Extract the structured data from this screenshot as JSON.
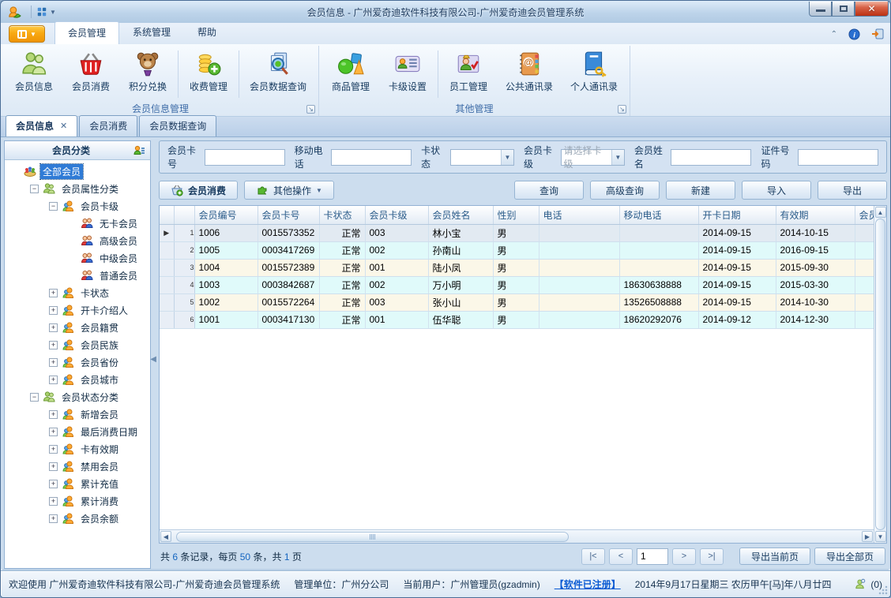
{
  "window": {
    "title": "会员信息 - 广州爱奇迪软件科技有限公司-广州爱奇迪会员管理系统"
  },
  "ribbon": {
    "tabs": [
      "会员管理",
      "系统管理",
      "帮助"
    ],
    "groups": [
      {
        "label": "会员信息管理",
        "buttons": [
          {
            "label": "会员信息",
            "icon": "members-icon"
          },
          {
            "label": "会员消费",
            "icon": "basket-icon"
          },
          {
            "label": "积分兑换",
            "icon": "teddy-icon"
          },
          {
            "label": "收费管理",
            "icon": "coins-icon"
          },
          {
            "label": "会员数据查询",
            "icon": "doc-search-icon"
          }
        ]
      },
      {
        "label": "其他管理",
        "buttons": [
          {
            "label": "商品管理",
            "icon": "goods-icon"
          },
          {
            "label": "卡级设置",
            "icon": "card-icon"
          },
          {
            "label": "员工管理",
            "icon": "staff-icon"
          },
          {
            "label": "公共通讯录",
            "icon": "address-book-icon"
          },
          {
            "label": "个人通讯录",
            "icon": "personal-book-icon"
          }
        ]
      }
    ]
  },
  "doc_tabs": [
    "会员信息",
    "会员消费",
    "会员数据查询"
  ],
  "sidebar": {
    "header": "会员分类",
    "tree": [
      {
        "label": "全部会员",
        "level": 0,
        "expander": "none",
        "icon": "root",
        "selected": true
      },
      {
        "label": "会员属性分类",
        "level": 1,
        "expander": "minus",
        "icon": "cat"
      },
      {
        "label": "会员卡级",
        "level": 2,
        "expander": "minus",
        "icon": "sub"
      },
      {
        "label": "无卡会员",
        "level": 3,
        "expander": "none",
        "icon": "leaf"
      },
      {
        "label": "高级会员",
        "level": 3,
        "expander": "none",
        "icon": "leaf"
      },
      {
        "label": "中级会员",
        "level": 3,
        "expander": "none",
        "icon": "leaf"
      },
      {
        "label": "普通会员",
        "level": 3,
        "expander": "none",
        "icon": "leaf"
      },
      {
        "label": "卡状态",
        "level": 2,
        "expander": "plus",
        "icon": "sub"
      },
      {
        "label": "开卡介绍人",
        "level": 2,
        "expander": "plus",
        "icon": "sub"
      },
      {
        "label": "会员籍贯",
        "level": 2,
        "expander": "plus",
        "icon": "sub"
      },
      {
        "label": "会员民族",
        "level": 2,
        "expander": "plus",
        "icon": "sub"
      },
      {
        "label": "会员省份",
        "level": 2,
        "expander": "plus",
        "icon": "sub"
      },
      {
        "label": "会员城市",
        "level": 2,
        "expander": "plus",
        "icon": "sub"
      },
      {
        "label": "会员状态分类",
        "level": 1,
        "expander": "minus",
        "icon": "cat"
      },
      {
        "label": "新增会员",
        "level": 2,
        "expander": "plus",
        "icon": "sub"
      },
      {
        "label": "最后消费日期",
        "level": 2,
        "expander": "plus",
        "icon": "sub"
      },
      {
        "label": "卡有效期",
        "level": 2,
        "expander": "plus",
        "icon": "sub"
      },
      {
        "label": "禁用会员",
        "level": 2,
        "expander": "plus",
        "icon": "sub"
      },
      {
        "label": "累计充值",
        "level": 2,
        "expander": "plus",
        "icon": "sub"
      },
      {
        "label": "累计消费",
        "level": 2,
        "expander": "plus",
        "icon": "sub"
      },
      {
        "label": "会员余额",
        "level": 2,
        "expander": "plus",
        "icon": "sub"
      }
    ]
  },
  "filters": [
    {
      "label": "会员卡号",
      "type": "input",
      "value": ""
    },
    {
      "label": "移动电话",
      "type": "input",
      "value": ""
    },
    {
      "label": "卡状态",
      "type": "select",
      "value": ""
    },
    {
      "label": "会员卡级",
      "type": "select",
      "value": "请选择卡级"
    },
    {
      "label": "会员姓名",
      "type": "input",
      "value": ""
    },
    {
      "label": "证件号码",
      "type": "input",
      "value": ""
    }
  ],
  "toolbar": {
    "consume_label": "会员消费",
    "other_ops_label": "其他操作",
    "right_buttons": [
      "查询",
      "高级查询",
      "新建",
      "导入",
      "导出"
    ]
  },
  "table": {
    "columns": [
      "会员编号",
      "会员卡号",
      "卡状态",
      "会员卡级",
      "会员姓名",
      "性别",
      "电话",
      "移动电话",
      "开卡日期",
      "有效期",
      "会员"
    ],
    "rows": [
      {
        "num": "1",
        "current": true,
        "cells": [
          "1006",
          "0015573352",
          "正常",
          "003",
          "林小宝",
          "男",
          "",
          "",
          "2014-09-15",
          "2014-10-15",
          ""
        ]
      },
      {
        "num": "2",
        "current": false,
        "cells": [
          "1005",
          "0003417269",
          "正常",
          "002",
          "孙南山",
          "男",
          "",
          "",
          "2014-09-15",
          "2016-09-15",
          ""
        ]
      },
      {
        "num": "3",
        "current": false,
        "cells": [
          "1004",
          "0015572389",
          "正常",
          "001",
          "陆小凤",
          "男",
          "",
          "",
          "2014-09-15",
          "2015-09-30",
          ""
        ]
      },
      {
        "num": "4",
        "current": false,
        "cells": [
          "1003",
          "0003842687",
          "正常",
          "002",
          "万小明",
          "男",
          "",
          "18630638888",
          "2014-09-15",
          "2015-03-30",
          ""
        ]
      },
      {
        "num": "5",
        "current": false,
        "cells": [
          "1002",
          "0015572264",
          "正常",
          "003",
          "张小山",
          "男",
          "",
          "13526508888",
          "2014-09-15",
          "2014-10-30",
          ""
        ]
      },
      {
        "num": "6",
        "current": false,
        "cells": [
          "1001",
          "0003417130",
          "正常",
          "001",
          "伍华聪",
          "男",
          "",
          "18620292076",
          "2014-09-12",
          "2014-12-30",
          ""
        ]
      }
    ]
  },
  "pagination": {
    "t1": "共",
    "n1": "6",
    "t2": "条记录，每页",
    "n2": "50",
    "t3": "条，共",
    "n3": "1",
    "t4": "页",
    "first": "|<",
    "prev": "<",
    "page": "1",
    "next": ">",
    "last": ">|",
    "export_current": "导出当前页",
    "export_all": "导出全部页"
  },
  "statusbar": {
    "welcome": "欢迎使用 广州爱奇迪软件科技有限公司-广州爱奇迪会员管理系统",
    "org": "管理单位：广州分公司",
    "user": "当前用户：广州管理员(gzadmin)",
    "registered": "【软件已注册】",
    "date": "2014年9月17日星期三 农历甲午[马]年八月廿四",
    "msg_count": "(0)"
  }
}
